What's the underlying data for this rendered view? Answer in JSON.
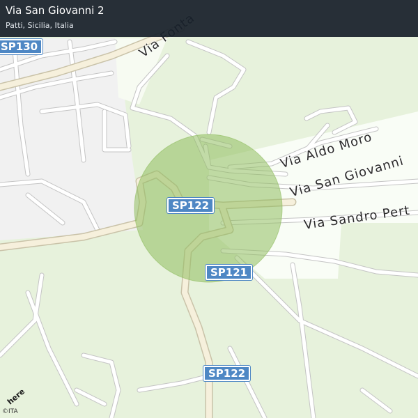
{
  "header": {
    "title": "Via San Giovanni 2",
    "subtitle": "Patti, Sicilia, Italia"
  },
  "map": {
    "colors": {
      "land": "#e7f2dc",
      "urban": "#f1f1f1",
      "park": "#ffffff",
      "road_casing": "#bfbfbf",
      "road": "#ffffff",
      "major_road": "#f6f0dc",
      "highlight_circle": "#8fbd5f",
      "shield": "#4e87c4",
      "header_bg": "#18202a"
    },
    "route_shields": [
      {
        "name": "sp130",
        "label": "SP130"
      },
      {
        "name": "sp122-top",
        "label": "SP122"
      },
      {
        "name": "sp121",
        "label": "SP121"
      },
      {
        "name": "sp122-bottom",
        "label": "SP122"
      }
    ],
    "street_labels": [
      {
        "name": "via-fonta",
        "label": "Via   Fonta"
      },
      {
        "name": "via-aldo-moro",
        "label": "Via  Aldo  Moro"
      },
      {
        "name": "via-san-giovanni",
        "label": "Via  San  Giovanni"
      },
      {
        "name": "via-sandro-pert",
        "label": "Via  Sandro  Pert"
      }
    ],
    "logo": "here",
    "copyright": "©ITA"
  }
}
